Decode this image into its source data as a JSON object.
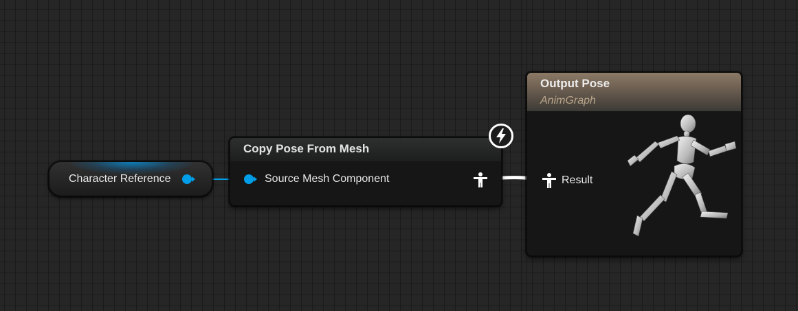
{
  "graph": {
    "variable_node": {
      "label": "Character Reference",
      "pin_color": "#009ee8"
    },
    "copy_pose_node": {
      "title": "Copy Pose From Mesh",
      "input_pin_label": "Source Mesh Component",
      "output_pin_icon": "pose-pin-icon",
      "badge_icon": "lightning-bolt-icon"
    },
    "output_pose_node": {
      "title": "Output Pose",
      "subtitle": "AnimGraph",
      "input_pin_label": "Result",
      "input_pin_icon": "pose-pin-icon",
      "preview_icon": "running-mannequin-icon"
    },
    "colors": {
      "object_pin": "#009ee8",
      "pose_wire": "#ffffff",
      "output_header": "#8c7a66",
      "canvas_background": "#262626"
    }
  }
}
